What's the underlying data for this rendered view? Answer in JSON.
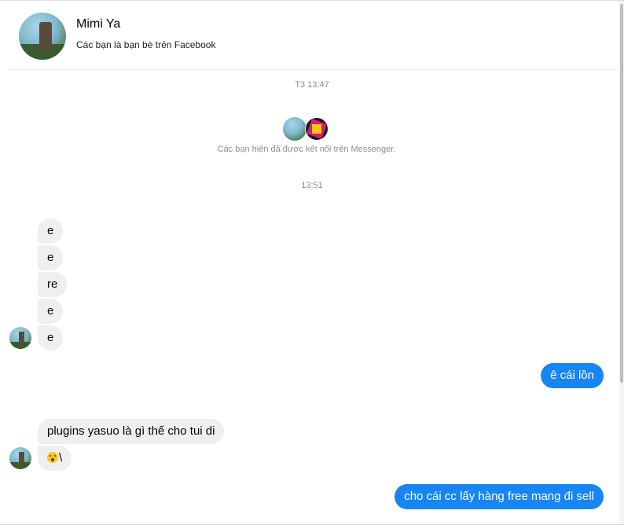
{
  "header": {
    "name": "Mimi Ya",
    "subtitle": "Các bạn là bạn bè trên Facebook"
  },
  "timestamps": {
    "first": "T3 13:47",
    "second": "13:51"
  },
  "connection_notice": "Các bạn hiện đã được kết nối trên Messenger.",
  "messages": [
    {
      "sender": "incoming",
      "text": "e"
    },
    {
      "sender": "incoming",
      "text": "e"
    },
    {
      "sender": "incoming",
      "text": "re"
    },
    {
      "sender": "incoming",
      "text": "e"
    },
    {
      "sender": "incoming",
      "text": "e"
    },
    {
      "sender": "outgoing",
      "text": "ê cái lồn"
    },
    {
      "sender": "incoming",
      "text": "plugins yasuo là gì thế cho tui di"
    },
    {
      "sender": "incoming",
      "text": "\\",
      "emoji": "astonished-face"
    },
    {
      "sender": "outgoing",
      "text": "cho cái cc lấy hàng free mang đi sell"
    }
  ],
  "colors": {
    "outgoing_bubble": "#1785f2",
    "incoming_bubble": "#efefef",
    "meta_text": "#8a8d91"
  }
}
